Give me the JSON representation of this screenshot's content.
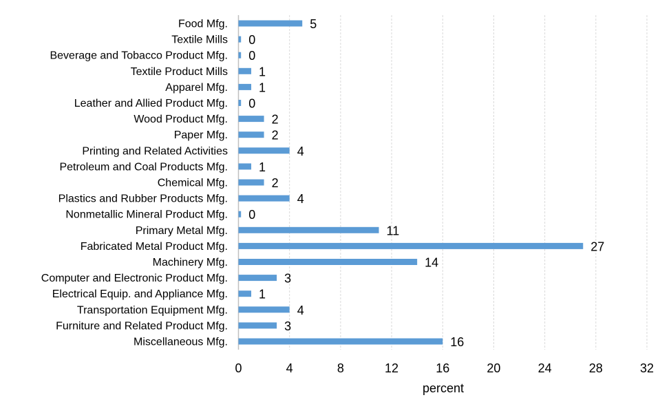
{
  "chart_data": {
    "type": "bar",
    "orientation": "horizontal",
    "title": "",
    "xlabel": "percent",
    "ylabel": "",
    "xlim": [
      0,
      32
    ],
    "xticks": [
      0,
      4,
      8,
      12,
      16,
      20,
      24,
      28,
      32
    ],
    "grid": "vertical dashed",
    "legend": "none",
    "bar_color": "#5b9bd5",
    "categories": [
      "Food Mfg.",
      "Textile Mills",
      "Beverage and Tobacco Product Mfg.",
      "Textile Product Mills",
      "Apparel Mfg.",
      "Leather and Allied Product Mfg.",
      "Wood Product Mfg.",
      "Paper Mfg.",
      "Printing and Related Activities",
      "Petroleum and Coal Products Mfg.",
      "Chemical Mfg.",
      "Plastics and Rubber Products Mfg.",
      "Nonmetallic Mineral Product Mfg.",
      "Primary Metal Mfg.",
      "Fabricated Metal Product Mfg.",
      "Machinery Mfg.",
      "Computer and Electronic Product Mfg.",
      "Electrical Equip. and Appliance Mfg.",
      "Transportation Equipment Mfg.",
      "Furniture and Related Product Mfg.",
      "Miscellaneous Mfg."
    ],
    "values": [
      5,
      0.2,
      0.2,
      1,
      1,
      0.2,
      2,
      2,
      4,
      1,
      2,
      4,
      0.2,
      11,
      27,
      14,
      3,
      1,
      4,
      3,
      16
    ],
    "data_labels": [
      "5",
      "0",
      "0",
      "1",
      "1",
      "0",
      "2",
      "2",
      "4",
      "1",
      "2",
      "4",
      "0",
      "11",
      "27",
      "14",
      "3",
      "1",
      "4",
      "3",
      "16"
    ]
  }
}
